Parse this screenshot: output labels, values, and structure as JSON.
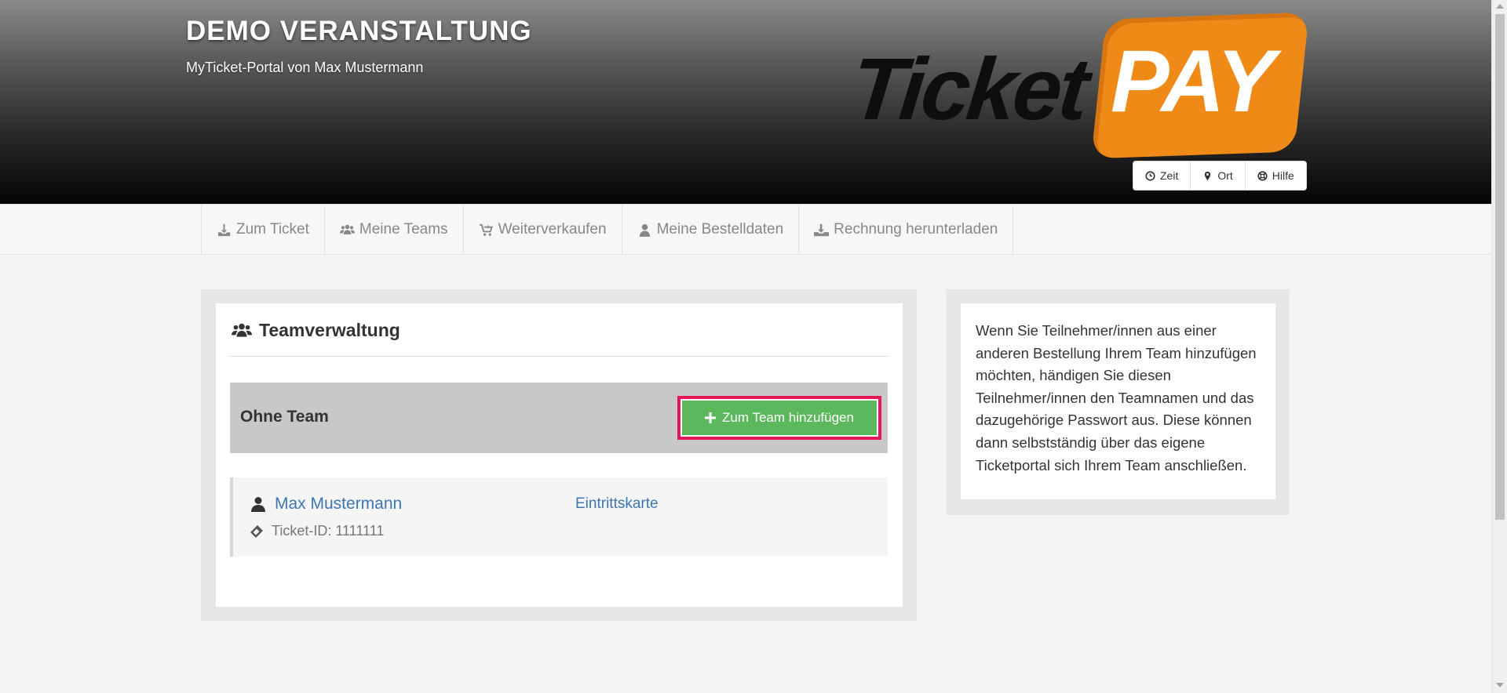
{
  "header": {
    "event_title": "DEMO VERANSTALTUNG",
    "event_subtitle": "MyTicket-Portal von Max Mustermann",
    "logo_text_black": "Ticket",
    "logo_text_orange": "PAY",
    "logo_orange_color": "#f08a16",
    "utility_buttons": [
      {
        "label": "Zeit",
        "icon": "clock-icon"
      },
      {
        "label": "Ort",
        "icon": "map-marker-icon"
      },
      {
        "label": "Hilfe",
        "icon": "life-ring-icon"
      }
    ]
  },
  "nav": {
    "items": [
      {
        "label": "Zum Ticket",
        "icon": "download-icon"
      },
      {
        "label": "Meine Teams",
        "icon": "users-icon"
      },
      {
        "label": "Weiterverkaufen",
        "icon": "cart-icon"
      },
      {
        "label": "Meine Bestelldaten",
        "icon": "user-icon"
      },
      {
        "label": "Rechnung herunterladen",
        "icon": "download-tray-icon"
      }
    ]
  },
  "main": {
    "heading": "Teamverwaltung",
    "heading_icon": "users-icon",
    "team_group_label": "Ohne Team",
    "add_button_label": "Zum Team hinzufügen",
    "add_button_color": "#5cb85c",
    "highlight_color": "#e5175b",
    "members": [
      {
        "name": "Max Mustermann",
        "ticket_id": "Ticket-ID: 1111111",
        "ticket_link": "Eintrittskarte"
      }
    ]
  },
  "sidebar": {
    "info_text": "Wenn Sie Teilnehmer/innen aus einer anderen Bestellung Ihrem Team hinzufügen möchten, händigen Sie diesen Teilnehmer/innen den Teamnamen und das dazugehörige Passwort aus. Diese können dann selbstständig über das eigene Ticketportal sich Ihrem Team anschließen."
  }
}
